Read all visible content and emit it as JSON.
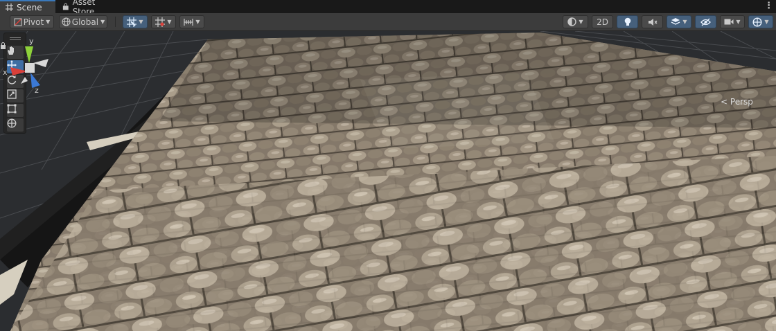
{
  "tabs": [
    {
      "label": "Scene",
      "icon": "grid-icon"
    },
    {
      "label": "Asset Store",
      "icon": "bag-icon"
    }
  ],
  "toolbar": {
    "pivot": "Pivot",
    "global": "Global",
    "mode_2d": "2D"
  },
  "view": {
    "projection": "Persp",
    "axes": {
      "x": "x",
      "y": "y",
      "z": "z"
    }
  },
  "colors": {
    "accent": "#3a79bb",
    "axis_x": "#d9403a",
    "axis_y": "#8ed13a",
    "axis_z": "#3b79d6",
    "ground": "#8a7c6a"
  }
}
